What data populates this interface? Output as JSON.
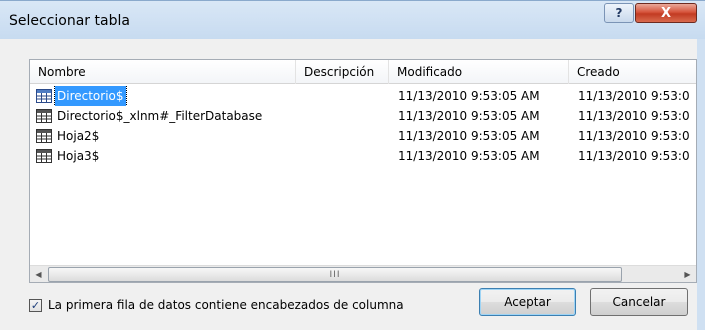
{
  "window": {
    "title": "Seleccionar tabla",
    "help_glyph": "?",
    "close_glyph": "X"
  },
  "listview": {
    "columns": [
      "Nombre",
      "Descripción",
      "Modificado",
      "Creado"
    ],
    "rows": [
      {
        "name": "Directorio$",
        "modified": "11/13/2010 9:53:05 AM",
        "created": "11/13/2010 9:53:0",
        "selected": true
      },
      {
        "name": "Directorio$_xlnm#_FilterDatabase",
        "modified": "11/13/2010 9:53:05 AM",
        "created": "11/13/2010 9:53:0",
        "selected": false
      },
      {
        "name": "Hoja2$",
        "modified": "11/13/2010 9:53:05 AM",
        "created": "11/13/2010 9:53:0",
        "selected": false
      },
      {
        "name": "Hoja3$",
        "modified": "11/13/2010 9:53:05 AM",
        "created": "11/13/2010 9:53:0",
        "selected": false
      }
    ],
    "scroll_thumb_glyph": "III",
    "scroll_left_glyph": "◀",
    "scroll_right_glyph": "▶"
  },
  "options": {
    "first_row_headers_label": "La primera fila de datos contiene encabezados de columna",
    "first_row_headers_checked": true,
    "check_glyph": "✓"
  },
  "buttons": {
    "accept": "Aceptar",
    "cancel": "Cancelar"
  },
  "icons": {
    "table": "table-icon"
  },
  "colors": {
    "selection": "#3399ff",
    "close_button": "#c23b22"
  }
}
